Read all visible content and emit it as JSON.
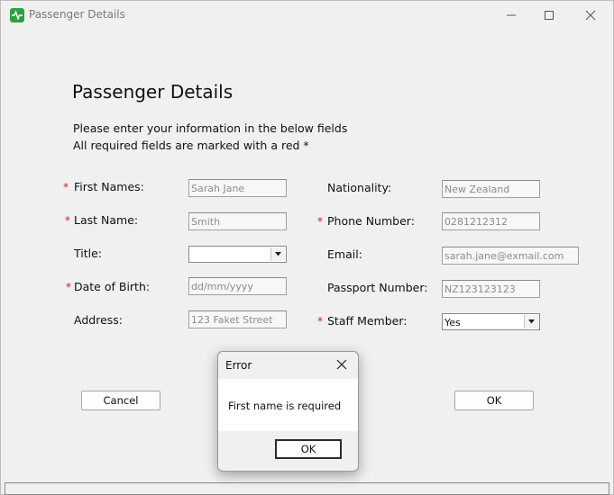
{
  "window": {
    "title": "Passenger Details"
  },
  "form": {
    "heading": "Passenger Details",
    "instructions": [
      "Please enter your information in the below fields",
      "All required fields are marked with a red *"
    ],
    "required_marker": "*",
    "left": {
      "first_names": {
        "label": "First Names:",
        "placeholder": "Sarah Jane"
      },
      "last_name": {
        "label": "Last Name:",
        "placeholder": "Smith"
      },
      "title": {
        "label": "Title:",
        "value": ""
      },
      "dob": {
        "label": "Date of Birth:",
        "placeholder": "dd/mm/yyyy"
      },
      "address": {
        "label": "Address:",
        "placeholder": "123 Faket Street"
      }
    },
    "right": {
      "nationality": {
        "label": "Nationality:",
        "placeholder": "New Zealand"
      },
      "phone": {
        "label": "Phone Number:",
        "placeholder": "0281212312"
      },
      "email": {
        "label": "Email:",
        "placeholder": "sarah.jane@exmail.com"
      },
      "passport": {
        "label": "Passport Number:",
        "placeholder": "NZ123123123"
      },
      "staff": {
        "label": "Staff Member:",
        "value": "Yes"
      }
    },
    "buttons": {
      "cancel": "Cancel",
      "ok": "OK"
    }
  },
  "dialog": {
    "title": "Error",
    "message": "First name is required",
    "ok_label": "OK"
  },
  "colors": {
    "required": "#cc1c1c",
    "app_icon": "#2ea043"
  },
  "icons": [
    "app-icon",
    "minimize-icon",
    "maximize-icon",
    "close-icon",
    "chevron-down-icon"
  ]
}
